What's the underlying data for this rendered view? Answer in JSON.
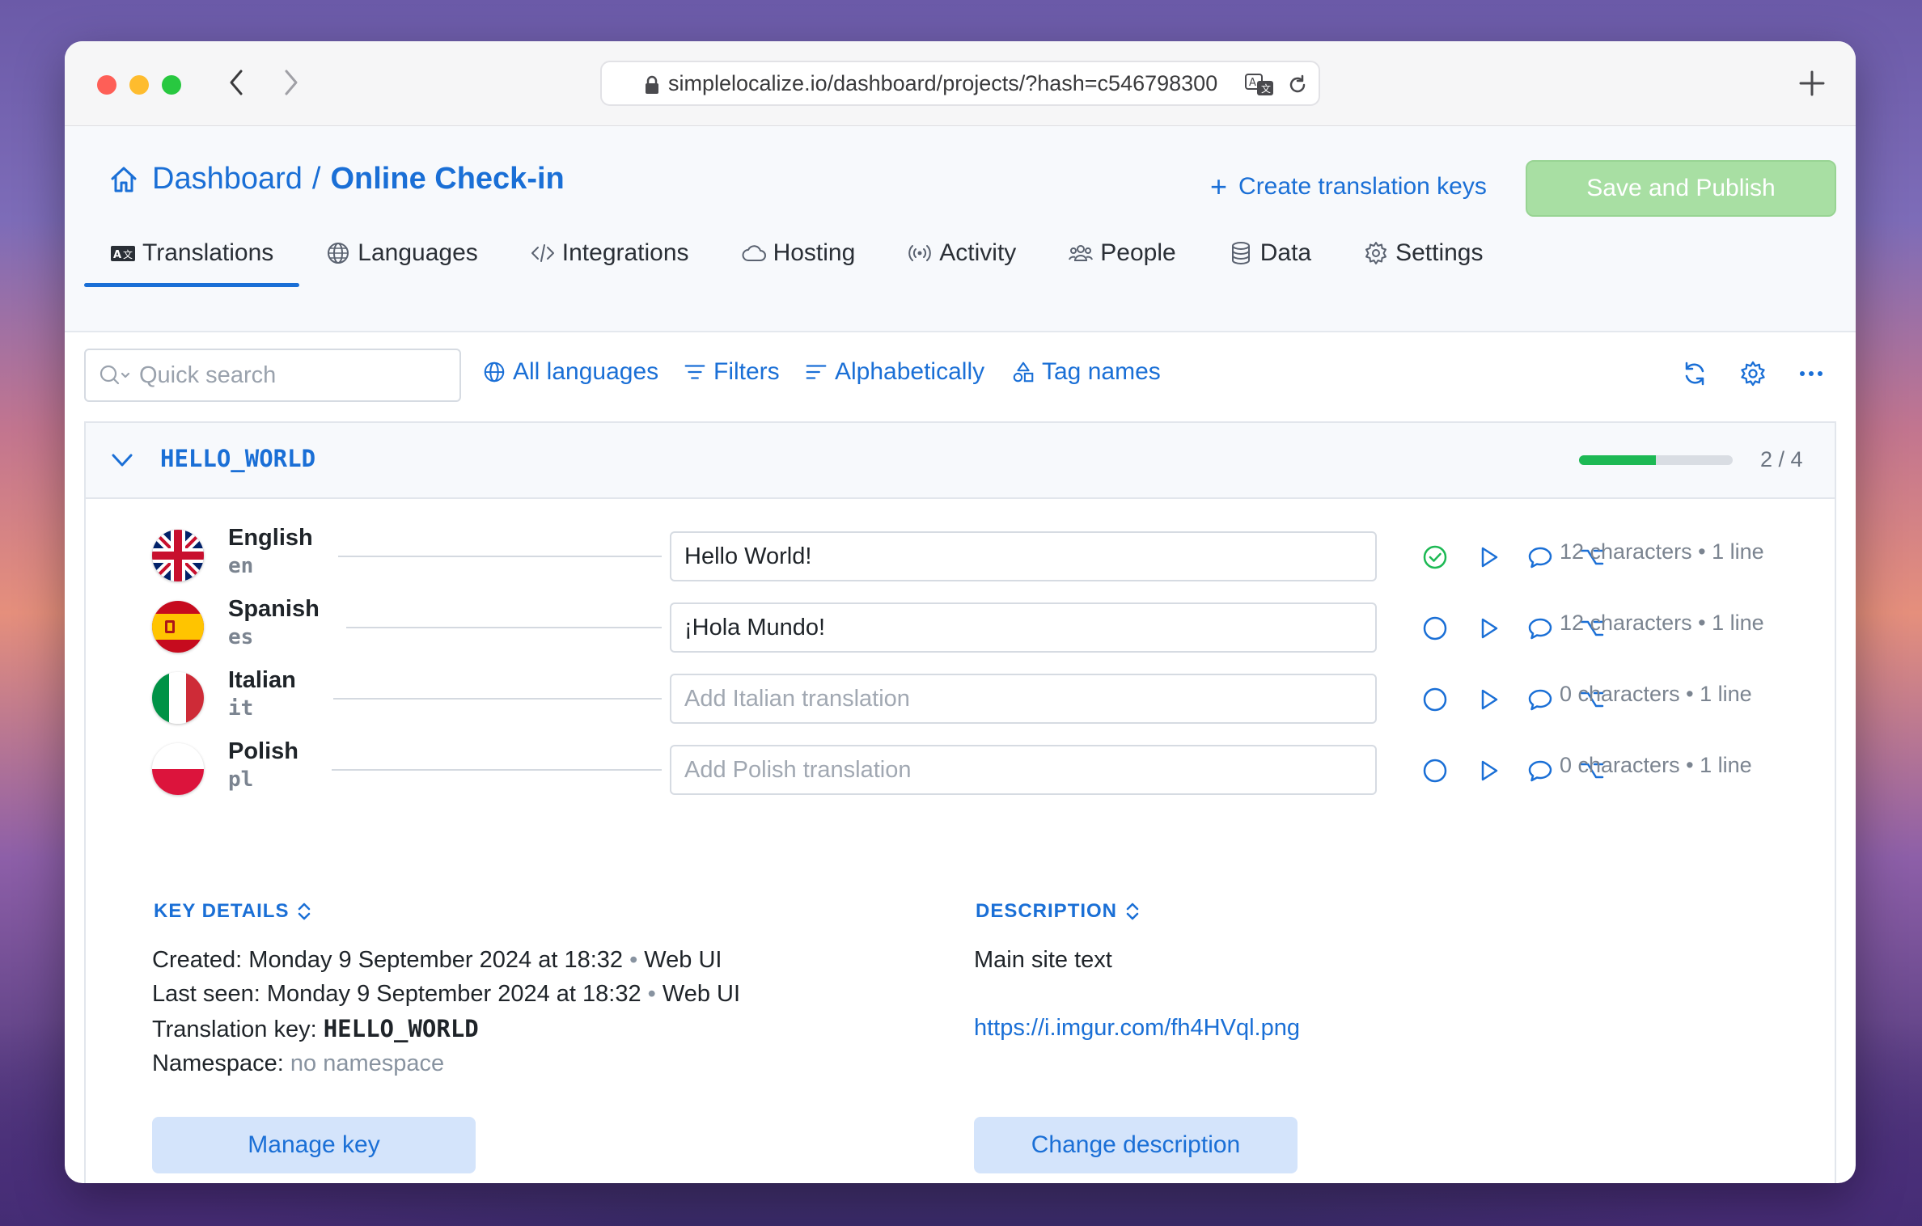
{
  "browser": {
    "url": "simplelocalize.io/dashboard/projects/?hash=c546798300"
  },
  "breadcrumb": {
    "root": "Dashboard",
    "separator": "/",
    "current": "Online Check-in"
  },
  "header": {
    "create_keys_label": "Create translation keys",
    "save_label": "Save and Publish"
  },
  "tabs": [
    {
      "label": "Translations",
      "icon": "translate-box-icon"
    },
    {
      "label": "Languages",
      "icon": "globe-icon"
    },
    {
      "label": "Integrations",
      "icon": "code-icon"
    },
    {
      "label": "Hosting",
      "icon": "cloud-icon"
    },
    {
      "label": "Activity",
      "icon": "broadcast-icon"
    },
    {
      "label": "People",
      "icon": "people-icon"
    },
    {
      "label": "Data",
      "icon": "database-icon"
    },
    {
      "label": "Settings",
      "icon": "gear-icon"
    }
  ],
  "toolbar": {
    "search_placeholder": "Quick search",
    "all_languages": "All languages",
    "filters": "Filters",
    "sort": "Alphabetically",
    "tag_names": "Tag names"
  },
  "key": {
    "name": "HELLO_WORLD",
    "progress_text": "2 / 4",
    "progress_fraction": 0.5
  },
  "languages": [
    {
      "name": "English",
      "code": "en",
      "value": "Hello World!",
      "placeholder": "",
      "status": "done",
      "chars": "12 characters",
      "lines": "1 line"
    },
    {
      "name": "Spanish",
      "code": "es",
      "value": "¡Hola Mundo!",
      "placeholder": "",
      "status": "pending",
      "chars": "12 characters",
      "lines": "1 line"
    },
    {
      "name": "Italian",
      "code": "it",
      "value": "",
      "placeholder": "Add Italian translation",
      "status": "pending",
      "chars": "0 characters",
      "lines": "1 line"
    },
    {
      "name": "Polish",
      "code": "pl",
      "value": "",
      "placeholder": "Add Polish translation",
      "status": "pending",
      "chars": "0 characters",
      "lines": "1 line"
    }
  ],
  "key_details": {
    "title": "KEY DETAILS",
    "created_label": "Created:",
    "created_value": "Monday 9 September 2024 at 18:32",
    "created_source": "Web UI",
    "last_seen_label": "Last seen:",
    "last_seen_value": "Monday 9 September 2024 at 18:32",
    "last_seen_source": "Web UI",
    "translation_key_label": "Translation key:",
    "translation_key_value": "HELLO_WORLD",
    "namespace_label": "Namespace:",
    "namespace_value": "no namespace",
    "manage_button": "Manage key"
  },
  "description": {
    "title": "DESCRIPTION",
    "text": "Main site text",
    "link": "https://i.imgur.com/fh4HVql.png",
    "change_button": "Change description"
  },
  "colors": {
    "accent": "#1a6fd6",
    "success": "#1db954",
    "save_disabled": "#a8dfa3"
  },
  "dot_separator": "•"
}
